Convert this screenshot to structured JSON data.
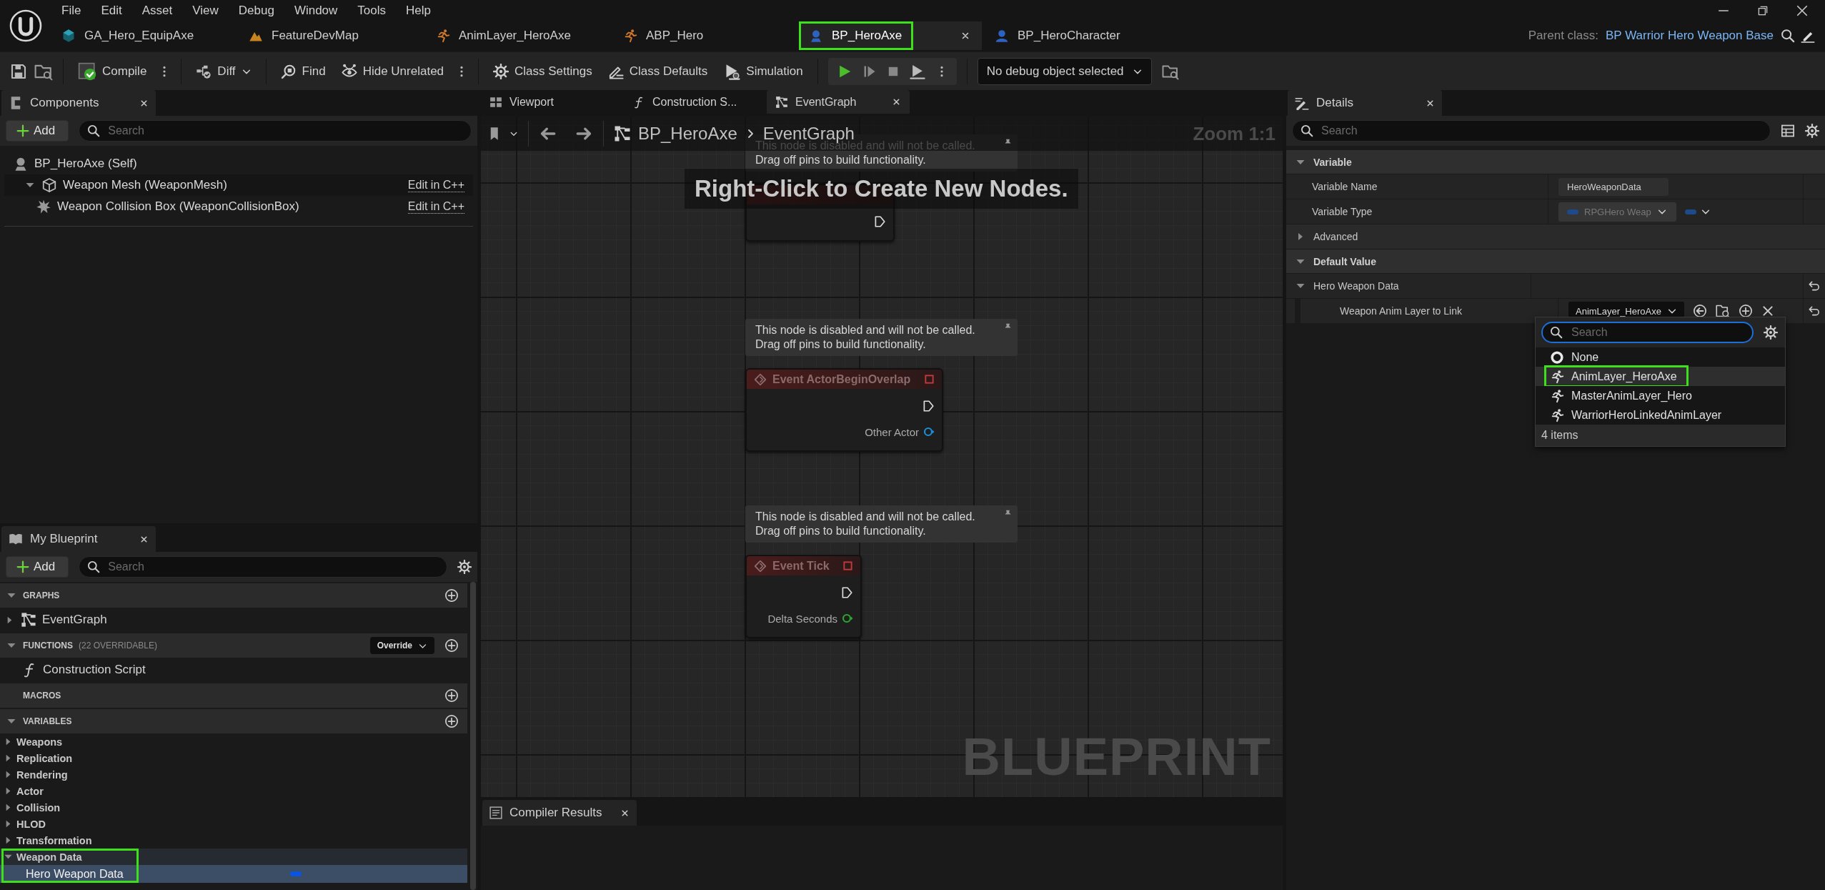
{
  "menu": [
    "File",
    "Edit",
    "Asset",
    "View",
    "Debug",
    "Window",
    "Tools",
    "Help"
  ],
  "document_tabs": [
    {
      "label": "GA_Hero_EquipAxe",
      "selected": false,
      "highlighted": false
    },
    {
      "label": "FeatureDevMap",
      "selected": false,
      "highlighted": false
    },
    {
      "label": "AnimLayer_HeroAxe",
      "selected": false,
      "highlighted": false
    },
    {
      "label": "ABP_Hero",
      "selected": false,
      "highlighted": false
    },
    {
      "label": "BP_HeroAxe",
      "selected": true,
      "highlighted": true
    },
    {
      "label": "BP_HeroCharacter",
      "selected": false,
      "highlighted": false
    }
  ],
  "parent_class": {
    "label": "Parent class:",
    "value": "BP Warrior Hero Weapon Base"
  },
  "toolbar": {
    "compile": "Compile",
    "diff": "Diff",
    "find": "Find",
    "hide_unrelated": "Hide Unrelated",
    "class_settings": "Class Settings",
    "class_defaults": "Class Defaults",
    "simulation": "Simulation",
    "debug_object": "No debug object selected"
  },
  "components": {
    "title": "Components",
    "add": "Add",
    "search_placeholder": "Search",
    "tree": [
      {
        "label": "BP_HeroAxe (Self)",
        "children": [
          {
            "label": "Weapon Mesh (WeaponMesh)",
            "link": "Edit in C++",
            "expanded": true,
            "children": [
              {
                "label": "Weapon Collision Box (WeaponCollisionBox)",
                "link": "Edit in C++"
              }
            ]
          }
        ]
      }
    ]
  },
  "my_blueprint": {
    "title": "My Blueprint",
    "add": "Add",
    "search_placeholder": "Search",
    "sections": [
      {
        "kind": "graphs",
        "title": "GRAPHS",
        "expanded": true,
        "items": [
          {
            "label": "EventGraph",
            "expanded": false
          }
        ]
      },
      {
        "kind": "functions",
        "title": "FUNCTIONS",
        "note": "(22 OVERRIDABLE)",
        "override": "Override",
        "expanded": true,
        "items": [
          {
            "label": "Construction Script"
          }
        ]
      },
      {
        "kind": "macros",
        "title": "MACROS"
      },
      {
        "kind": "variables",
        "title": "VARIABLES",
        "expanded": true,
        "items": [
          {
            "label": "Weapons",
            "expanded": false,
            "highlighted": false
          },
          {
            "label": "Replication",
            "expanded": false,
            "highlighted": false
          },
          {
            "label": "Rendering",
            "expanded": false,
            "highlighted": false
          },
          {
            "label": "Actor",
            "expanded": false,
            "highlighted": false
          },
          {
            "label": "Collision",
            "expanded": false,
            "highlighted": false
          },
          {
            "label": "HLOD",
            "expanded": false,
            "highlighted": false
          },
          {
            "label": "Transformation",
            "expanded": false,
            "highlighted": false
          },
          {
            "label": "Weapon Data",
            "expanded": true,
            "highlighted": true,
            "children": [
              {
                "label": "Hero Weapon Data",
                "selected": true
              }
            ]
          }
        ]
      }
    ]
  },
  "graph": {
    "tabs": [
      {
        "label": "Viewport",
        "selected": false
      },
      {
        "label": "Construction S...",
        "selected": false
      },
      {
        "label": "EventGraph",
        "selected": true
      }
    ],
    "breadcrumb": [
      "BP_HeroAxe",
      "EventGraph"
    ],
    "zoom": "Zoom 1:1",
    "hint": "Right-Click to Create New Nodes.",
    "watermark": "BLUEPRINT",
    "nodes": [
      {
        "comment": [
          "This node is disabled and will not be called.",
          "Drag off pins to build functionality."
        ]
      },
      {
        "comment": [
          "This node is disabled and will not be called.",
          "Drag off pins to build functionality."
        ],
        "title": "Event ActorBeginOverlap",
        "pins": [
          {
            "label": "Other Actor",
            "color": "#1a8fd6"
          }
        ]
      },
      {
        "comment": [
          "This node is disabled and will not be called.",
          "Drag off pins to build functionality."
        ],
        "title": "Event Tick",
        "pins": [
          {
            "label": "Delta Seconds",
            "color": "#2ea62e"
          }
        ]
      }
    ]
  },
  "compiler_results": {
    "title": "Compiler Results"
  },
  "details": {
    "title": "Details",
    "search_placeholder": "Search",
    "rows": [
      {
        "kind": "category",
        "label": "Variable",
        "expanded": true
      },
      {
        "kind": "text",
        "label": "Variable Name",
        "value": "HeroWeaponData"
      },
      {
        "kind": "type",
        "label": "Variable Type",
        "value": "RPGHero Weap"
      },
      {
        "kind": "group",
        "label": "Advanced",
        "expanded": false
      },
      {
        "kind": "category",
        "label": "Default Value",
        "expanded": true
      },
      {
        "kind": "group",
        "label": "Hero Weapon Data",
        "expanded": true,
        "reset": true
      },
      {
        "kind": "asset",
        "label": "Weapon Anim Layer to Link",
        "value": "AnimLayer_HeroAxe",
        "reset": true
      }
    ],
    "picker": {
      "search_placeholder": "Search",
      "items": [
        {
          "label": "None",
          "kind": "none",
          "selected": false,
          "highlighted": false
        },
        {
          "label": "AnimLayer_HeroAxe",
          "kind": "anim",
          "selected": true,
          "highlighted": true
        },
        {
          "label": "MasterAnimLayer_Hero",
          "kind": "anim",
          "selected": false,
          "highlighted": false
        },
        {
          "label": "WarriorHeroLinkedAnimLayer",
          "kind": "anim",
          "selected": false,
          "highlighted": false
        }
      ],
      "count": "4 items"
    }
  }
}
